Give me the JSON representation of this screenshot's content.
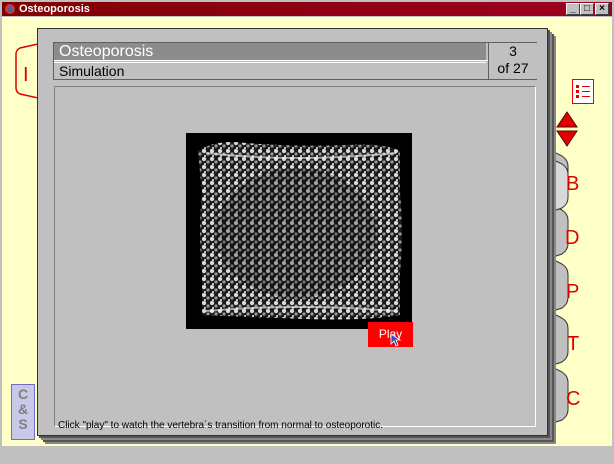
{
  "window": {
    "title": "Osteoporosis",
    "min_label": "_",
    "max_label": "□",
    "close_label": "×"
  },
  "header": {
    "title": "Osteoporosis",
    "subtitle": "Simulation",
    "page_current": "3",
    "page_total": "of 27"
  },
  "image": {
    "description_icon": "vertebra-image"
  },
  "play_button": {
    "label": "Play"
  },
  "caption": "Click \"play\" to watch the vertebra´s transition from normal to osteoporotic.",
  "tabs": {
    "left": "I",
    "cs_lines": [
      "C",
      "&",
      "S"
    ],
    "right": [
      "B",
      "D",
      "P",
      "T",
      "C"
    ]
  },
  "colors": {
    "accent": "#e00000",
    "client_bg": "#ffffc8",
    "page_bg": "#c0c0c0",
    "titlebar": "#800000"
  }
}
